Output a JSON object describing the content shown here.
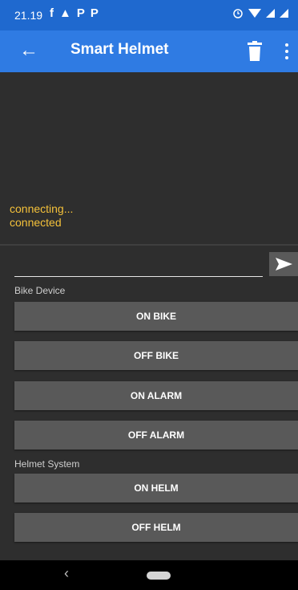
{
  "status_bar": {
    "time": "21.19",
    "left_icons": [
      "facebook-icon",
      "ship-icon",
      "parking-icon",
      "parking-icon"
    ],
    "left_glyphs": [
      "f",
      "▲",
      "P",
      "P"
    ],
    "right_icons": [
      "alarm-icon",
      "wifi-icon",
      "signal-icon",
      "signal-icon"
    ]
  },
  "app_bar": {
    "title": "Smart Helmet",
    "back_glyph": "←",
    "color": "#2f7be3",
    "status_color": "#1f69cf"
  },
  "log": {
    "lines": [
      "connecting...",
      "connected"
    ],
    "color": "#f4c13a"
  },
  "input": {
    "value": "",
    "placeholder": ""
  },
  "sections": {
    "bike": {
      "label": "Bike Device",
      "buttons": [
        "ON BIKE",
        "OFF BIKE",
        "ON ALARM",
        "OFF ALARM"
      ]
    },
    "helmet": {
      "label": "Helmet System",
      "buttons": [
        "ON HELM",
        "OFF HELM"
      ]
    }
  },
  "nav_bar": {
    "back_glyph": "‹"
  }
}
